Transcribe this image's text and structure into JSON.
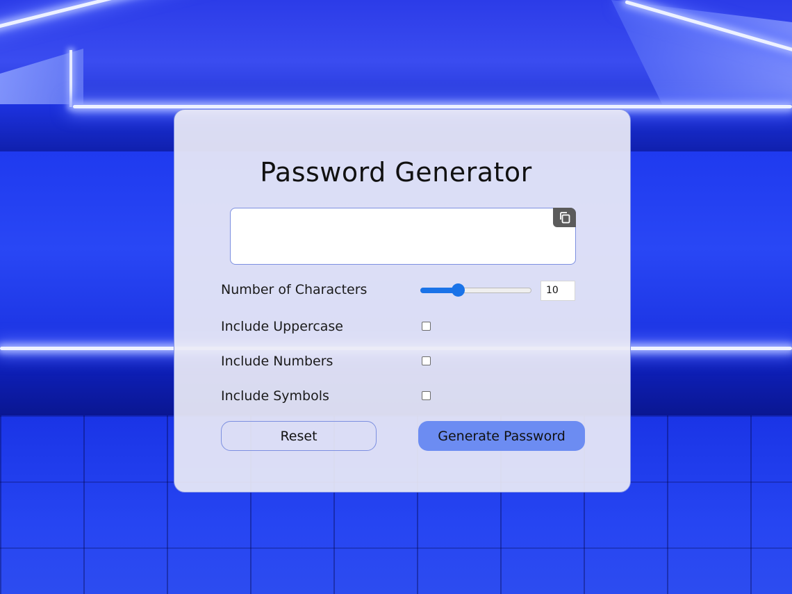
{
  "app": {
    "title": "Password Generator"
  },
  "output": {
    "value": "",
    "copy_icon": "copy-icon"
  },
  "options": {
    "length_label": "Number of Characters",
    "length_value": "10",
    "length_slider": {
      "min": 0,
      "max": 50,
      "value": 10
    },
    "uppercase_label": "Include Uppercase",
    "uppercase_checked": false,
    "numbers_label": "Include Numbers",
    "numbers_checked": false,
    "symbols_label": "Include Symbols",
    "symbols_checked": false
  },
  "actions": {
    "reset_label": "Reset",
    "generate_label": "Generate Password"
  },
  "colors": {
    "accent": "#1a73e8",
    "generate_button": "#6c8cf2",
    "card_border": "#7c8fe0"
  }
}
